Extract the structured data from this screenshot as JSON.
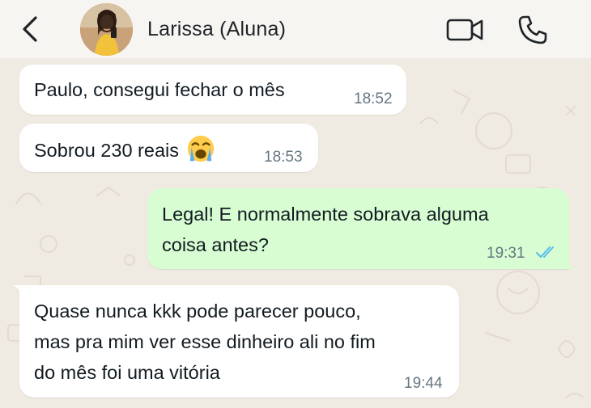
{
  "header": {
    "contact_name": "Larissa (Aluna)",
    "back_icon": "chevron-left-icon",
    "video_icon": "video-camera-icon",
    "call_icon": "phone-icon"
  },
  "colors": {
    "header_bg": "#f7f5f2",
    "chat_bg": "#efeae2",
    "incoming_bubble": "#ffffff",
    "outgoing_bubble": "#d9fdd3",
    "read_ticks": "#53bdeb",
    "timestamp": "#667781"
  },
  "messages": [
    {
      "direction": "incoming",
      "text": "Paulo, consegui fechar o mês",
      "time": "18:52"
    },
    {
      "direction": "incoming",
      "text": "Sobrou 230 reais",
      "emoji": "loudly-crying-face",
      "time": "18:53"
    },
    {
      "direction": "outgoing",
      "lines": [
        "Legal! E normalmente sobrava alguma",
        "coisa antes?"
      ],
      "time": "19:31",
      "status": "read"
    },
    {
      "direction": "incoming",
      "lines": [
        "Quase nunca kkk pode parecer pouco,",
        "mas pra mim ver esse dinheiro ali no fim",
        "do mês foi uma vitória"
      ],
      "time": "19:44"
    }
  ]
}
